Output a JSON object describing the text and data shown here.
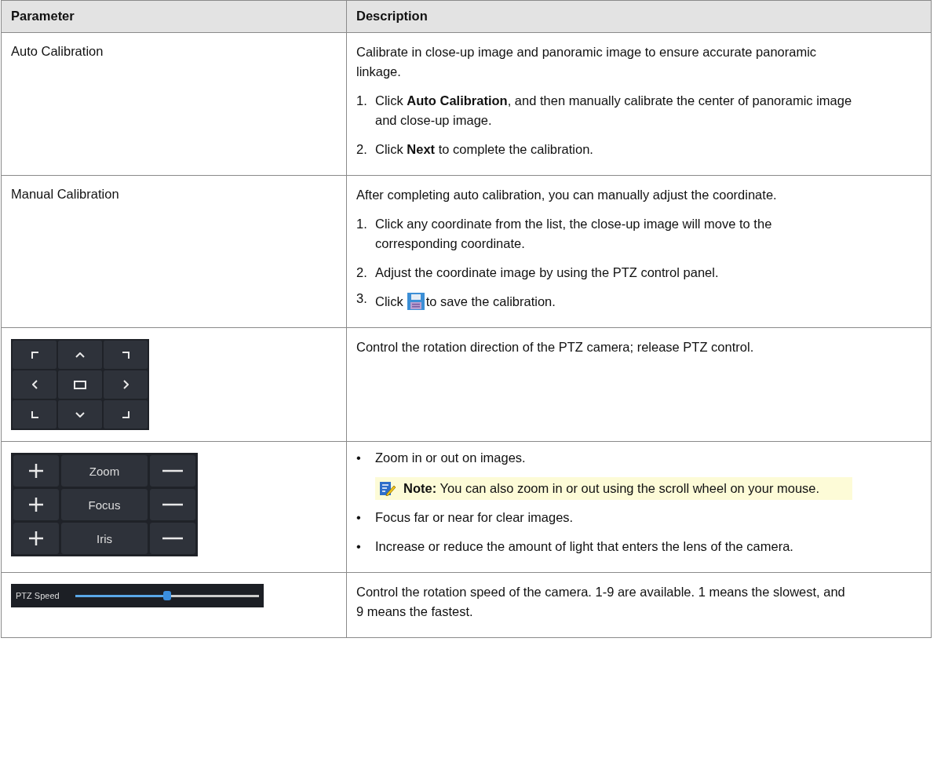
{
  "table": {
    "columns": [
      "Parameter",
      "Description"
    ],
    "rows": [
      {
        "parameter": {
          "kind": "text",
          "text": "Auto Calibration"
        },
        "description": [
          {
            "kind": "para",
            "text": "Calibrate in close-up image and panoramic image to ensure accurate panoramic linkage."
          },
          {
            "kind": "step",
            "number": "1.",
            "text": "Click **Auto Calibration**, and then manually calibrate the center of panoramic image and close-up image."
          },
          {
            "kind": "step",
            "number": "2.",
            "text": "Click **Next** to complete the calibration."
          }
        ]
      },
      {
        "parameter": {
          "kind": "text",
          "text": "Manual Calibration"
        },
        "description": [
          {
            "kind": "para",
            "text": "After completing auto calibration, you can manually adjust the coordinate."
          },
          {
            "kind": "step",
            "number": "1.",
            "text": "Click any coordinate from the list, the close-up image will move to the corresponding coordinate."
          },
          {
            "kind": "step",
            "number": "2.",
            "text": "Adjust the coordinate image by using the PTZ control panel."
          },
          {
            "kind": "step_icon",
            "number": "3.",
            "before": "Click",
            "after": "to save the calibration."
          }
        ]
      },
      {
        "parameter": {
          "kind": "direction_pad"
        },
        "description": [
          {
            "kind": "para",
            "text": "Control the rotation direction of the PTZ camera; release PTZ control."
          }
        ]
      },
      {
        "parameter": {
          "kind": "lens_controls",
          "labels": [
            "Zoom",
            "Focus",
            "Iris"
          ]
        },
        "description": [
          {
            "kind": "bullet",
            "marker": "•",
            "text": "Zoom in or out on images."
          },
          {
            "kind": "note",
            "text": "**Note:**  You can also zoom in or out using the scroll wheel on your mouse."
          },
          {
            "kind": "bullet",
            "marker": "•",
            "text": "Focus far or near for clear images."
          },
          {
            "kind": "bullet",
            "marker": "•",
            "text": "Increase or reduce the amount of light that enters the lens of the camera."
          }
        ]
      },
      {
        "parameter": {
          "kind": "speed_slider",
          "label": "PTZ Speed",
          "level": 0.5
        },
        "description": [
          {
            "kind": "para",
            "text": "Control the rotation speed of the camera. 1-9 are available. 1 means the slowest, and 9 means the fastest."
          }
        ]
      }
    ]
  }
}
